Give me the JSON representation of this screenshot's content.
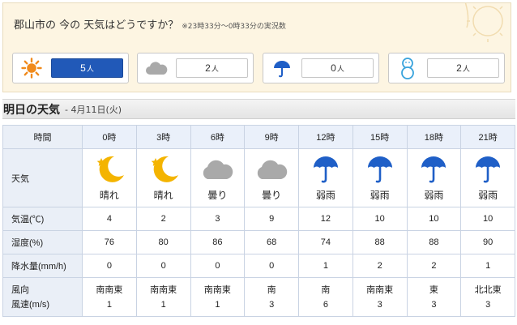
{
  "now": {
    "title": "郡山市の 今の 天気はどうですか？",
    "note": "※23時33分～0時33分の実況数",
    "votes": [
      {
        "icon": "sun-icon",
        "count": "5",
        "unit": "人",
        "active": true
      },
      {
        "icon": "cloud-icon",
        "count": "2",
        "unit": "人",
        "active": false
      },
      {
        "icon": "umbrella-icon",
        "count": "0",
        "unit": "人",
        "active": false
      },
      {
        "icon": "snowman-icon",
        "count": "2",
        "unit": "人",
        "active": false
      }
    ]
  },
  "forecast": {
    "title": "明日の天気",
    "date": "- 4月11日(火)",
    "labels": {
      "time": "時間",
      "weather": "天気",
      "temp": "気温(℃)",
      "humidity": "湿度(%)",
      "precip": "降水量(mm/h)",
      "wind_dir": "風向",
      "wind_speed": "風速(m/s)"
    },
    "hours": [
      "0時",
      "3時",
      "6時",
      "9時",
      "12時",
      "15時",
      "18時",
      "21時"
    ],
    "icons": [
      "moon-icon",
      "moon-icon",
      "cloud-icon",
      "cloud-icon",
      "umbrella-icon",
      "umbrella-icon",
      "umbrella-icon",
      "umbrella-icon"
    ],
    "weather": [
      "晴れ",
      "晴れ",
      "曇り",
      "曇り",
      "弱雨",
      "弱雨",
      "弱雨",
      "弱雨"
    ],
    "temp": [
      "4",
      "2",
      "3",
      "9",
      "12",
      "10",
      "10",
      "10"
    ],
    "humidity": [
      "76",
      "80",
      "86",
      "68",
      "74",
      "88",
      "88",
      "90"
    ],
    "precip": [
      "0",
      "0",
      "0",
      "0",
      "1",
      "2",
      "2",
      "1"
    ],
    "wind_dir": [
      "南南東",
      "南南東",
      "南南東",
      "南",
      "南",
      "南南東",
      "東",
      "北北東"
    ],
    "wind_speed": [
      "1",
      "1",
      "1",
      "3",
      "6",
      "3",
      "3",
      "3"
    ]
  },
  "colors": {
    "accent": "#2159b8",
    "sun": "#f08a1c",
    "moon": "#f4b400",
    "cloud": "#a9a9a9",
    "umbrella": "#1f5fc7",
    "header_bg": "#eaf0fa"
  }
}
